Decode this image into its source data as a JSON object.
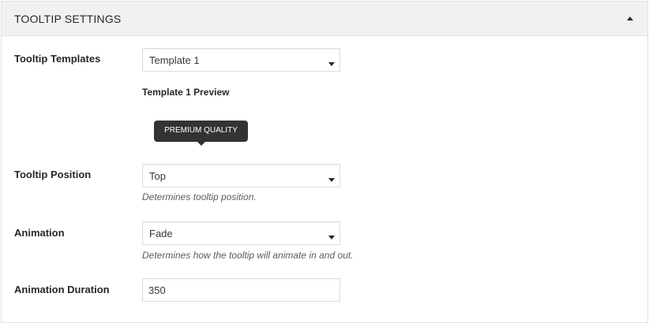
{
  "panel": {
    "title": "TOOLTIP SETTINGS",
    "collapse_icon": "triangle-up-icon"
  },
  "fields": {
    "templates": {
      "label": "Tooltip Templates",
      "selected": "Template 1"
    },
    "preview": {
      "title": "Template 1 Preview",
      "tooltip_text": "PREMIUM QUALITY"
    },
    "position": {
      "label": "Tooltip Position",
      "selected": "Top",
      "description": "Determines tooltip position."
    },
    "animation": {
      "label": "Animation",
      "selected": "Fade",
      "description": "Determines how the tooltip will animate in and out."
    },
    "duration": {
      "label": "Animation Duration",
      "value": "350"
    }
  },
  "colors": {
    "header_bg": "#f1f1f1",
    "tooltip_bg": "#333333",
    "border": "#dddddd"
  }
}
